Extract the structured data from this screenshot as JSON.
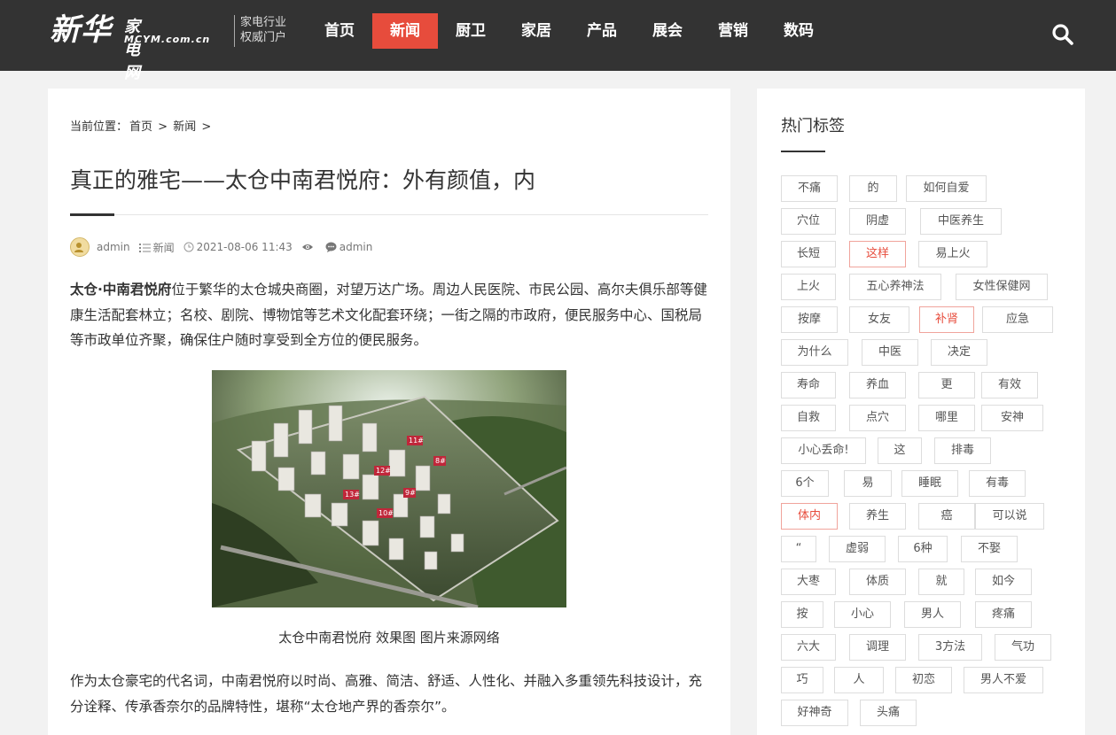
{
  "header": {
    "logo_main": "新华",
    "logo_sub": "家电网",
    "logo_domain": "MCYM.com.cn",
    "slogan_line1": "家电行业",
    "slogan_line2": "权威门户",
    "nav": [
      "首页",
      "新闻",
      "厨卫",
      "家居",
      "产品",
      "展会",
      "营销",
      "数码"
    ],
    "active_nav": "新闻",
    "search_icon": "search-icon"
  },
  "article": {
    "breadcrumb": [
      "当前位置：",
      "首页",
      " > ",
      "新闻",
      " >"
    ],
    "title": "真正的雅宅——太仓中南君悦府：外有颜值，内",
    "meta": {
      "author": "admin",
      "category": "新闻",
      "datetime": "2021-08-06 11:43",
      "views": "",
      "comment_author": "admin"
    },
    "para1_bold": "太仓·中南君悦府",
    "para1_rest": "位于繁华的太仓城央商圈，对望万达广场。周边人民医院、市民公园、高尔夫俱乐部等健康生活配套林立；名校、剧院、博物馆等艺术文化配套环绕；一街之隔的市政府，便民服务中心、国税局等市政单位齐聚，确保住户随时享受到全方位的便民服务。",
    "figure_labels": [
      "11#",
      "8#",
      "12#",
      "13#",
      "9#",
      "10#"
    ],
    "caption": "太仓中南君悦府 效果图 图片来源网络",
    "para2": "作为太仓豪宅的代名词，中南君悦府以时尚、高雅、简洁、舒适、人性化、并融入多重领先科技设计，充分诠释、传承香奈尔的品牌特性，堪称“太仓地产界的香奈尔”。"
  },
  "sidebar": {
    "title": "热门标签",
    "tags": [
      {
        "label": "不痛",
        "hot": false
      },
      {
        "label": "的",
        "hot": false
      },
      {
        "label": "如何自爱",
        "hot": false
      },
      {
        "label": "穴位",
        "hot": false
      },
      {
        "label": "阴虚",
        "hot": false
      },
      {
        "label": "中医养生",
        "hot": false
      },
      {
        "label": "长短",
        "hot": false
      },
      {
        "label": "这样",
        "hot": true
      },
      {
        "label": "易上火",
        "hot": false
      },
      {
        "label": "上火",
        "hot": false
      },
      {
        "label": "五心养神法",
        "hot": false
      },
      {
        "label": "女性保健网",
        "hot": false
      },
      {
        "label": "按摩",
        "hot": false
      },
      {
        "label": "女友",
        "hot": false
      },
      {
        "label": "补肾",
        "hot": true
      },
      {
        "label": "应急",
        "hot": false
      },
      {
        "label": "为什么",
        "hot": false
      },
      {
        "label": "中医",
        "hot": false
      },
      {
        "label": "决定",
        "hot": false
      },
      {
        "label": "寿命",
        "hot": false
      },
      {
        "label": "养血",
        "hot": false
      },
      {
        "label": "更",
        "hot": false
      },
      {
        "label": "有效",
        "hot": false
      },
      {
        "label": "自救",
        "hot": false
      },
      {
        "label": "点穴",
        "hot": false
      },
      {
        "label": "哪里",
        "hot": false
      },
      {
        "label": "安神",
        "hot": false
      },
      {
        "label": "小心丢命!",
        "hot": false
      },
      {
        "label": "这",
        "hot": false
      },
      {
        "label": "排毒",
        "hot": false
      },
      {
        "label": "6个",
        "hot": false
      },
      {
        "label": "易",
        "hot": false
      },
      {
        "label": "睡眠",
        "hot": false
      },
      {
        "label": "有毒",
        "hot": false
      },
      {
        "label": "体内",
        "hot": true
      },
      {
        "label": "养生",
        "hot": false
      },
      {
        "label": "癌",
        "hot": false
      },
      {
        "label": "可以说",
        "hot": false
      },
      {
        "label": "“",
        "hot": false
      },
      {
        "label": "虚弱",
        "hot": false
      },
      {
        "label": "6种",
        "hot": false
      },
      {
        "label": "不娶",
        "hot": false
      },
      {
        "label": "大枣",
        "hot": false
      },
      {
        "label": "体质",
        "hot": false
      },
      {
        "label": "就",
        "hot": false
      },
      {
        "label": "如今",
        "hot": false
      },
      {
        "label": "按",
        "hot": false
      },
      {
        "label": "小心",
        "hot": false
      },
      {
        "label": "男人",
        "hot": false
      },
      {
        "label": "疼痛",
        "hot": false
      },
      {
        "label": "六大",
        "hot": false
      },
      {
        "label": "调理",
        "hot": false
      },
      {
        "label": "3方法",
        "hot": false
      },
      {
        "label": "气功",
        "hot": false
      },
      {
        "label": "巧",
        "hot": false
      },
      {
        "label": "人",
        "hot": false
      },
      {
        "label": "初恋",
        "hot": false
      },
      {
        "label": "男人不爱",
        "hot": false
      },
      {
        "label": "好神奇",
        "hot": false
      },
      {
        "label": "头痛",
        "hot": false
      }
    ]
  }
}
